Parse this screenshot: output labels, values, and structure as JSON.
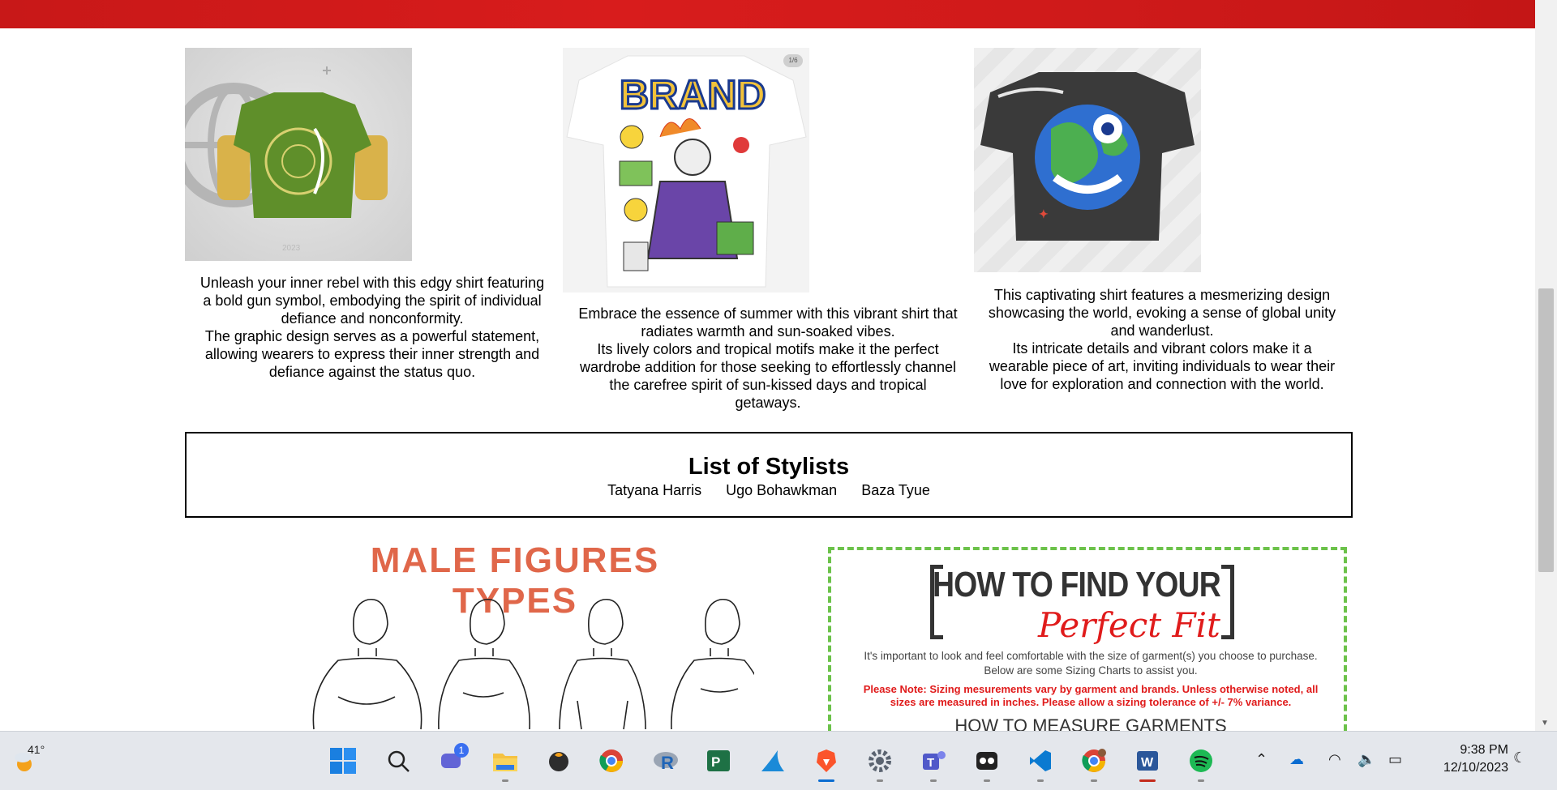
{
  "products": [
    {
      "description_lines": [
        "Unleash your inner rebel with this edgy shirt featuring",
        "a bold gun symbol, embodying the spirit of individual",
        "defiance and nonconformity.",
        "The graphic design serves as a powerful statement,",
        "allowing wearers to express their inner strength and",
        "defiance against the status quo."
      ],
      "image_watermark": "2023"
    },
    {
      "description_lines": [
        "Embrace the essence of summer with this vibrant shirt that",
        "radiates warmth and sun-soaked vibes.",
        "Its lively colors and tropical motifs make it the perfect",
        "wardrobe addition for those seeking to effortlessly channel",
        "the carefree spirit of sun-kissed days and tropical",
        "getaways."
      ],
      "image_counter": "1/6",
      "image_brand_text": "BRAND"
    },
    {
      "description_lines": [
        "This captivating shirt features a mesmerizing design",
        "showcasing the world, evoking a sense of global unity",
        "and wanderlust.",
        "Its intricate details and vibrant colors make it a",
        "wearable piece of art, inviting individuals to wear their",
        "love for exploration and connection with the world."
      ]
    }
  ],
  "stylists": {
    "title": "List of Stylists",
    "names": [
      "Tatyana Harris",
      "Ugo Bohawkman",
      "Baza Tyue"
    ]
  },
  "male_figures": {
    "title": "MALE FIGURES TYPES"
  },
  "sizing_chart": {
    "title_main": "HOW TO FIND YOUR",
    "title_script": "Perfect Fit",
    "intro_lines": [
      "It's important to look and feel comfortable with the size of garment(s) you choose to purchase.",
      "Below are some Sizing Charts to assist you."
    ],
    "note_lines": [
      "Please Note: Sizing mesurements vary by garment and brands. Unless otherwise noted, all",
      "sizes are measured in inches. Please allow a sizing tolerance of +/- 7% variance."
    ],
    "measure_heading": "HOW TO MEASURE GARMENTS"
  },
  "taskbar": {
    "weather_temp": "41°",
    "teams_badge": "1",
    "time": "9:38 PM",
    "date": "12/10/2023",
    "apps": [
      "start",
      "search",
      "teams-chat",
      "file-explorer",
      "fl-studio",
      "chrome",
      "r",
      "project",
      "shark",
      "brave",
      "settings",
      "teams",
      "imovie",
      "vscode",
      "chrome-profile",
      "word",
      "spotify"
    ]
  },
  "colors": {
    "header_red": "#d01a1a",
    "male_title": "#e0674a",
    "sizing_border": "#6cc24a",
    "sizing_red": "#e01b1b"
  }
}
